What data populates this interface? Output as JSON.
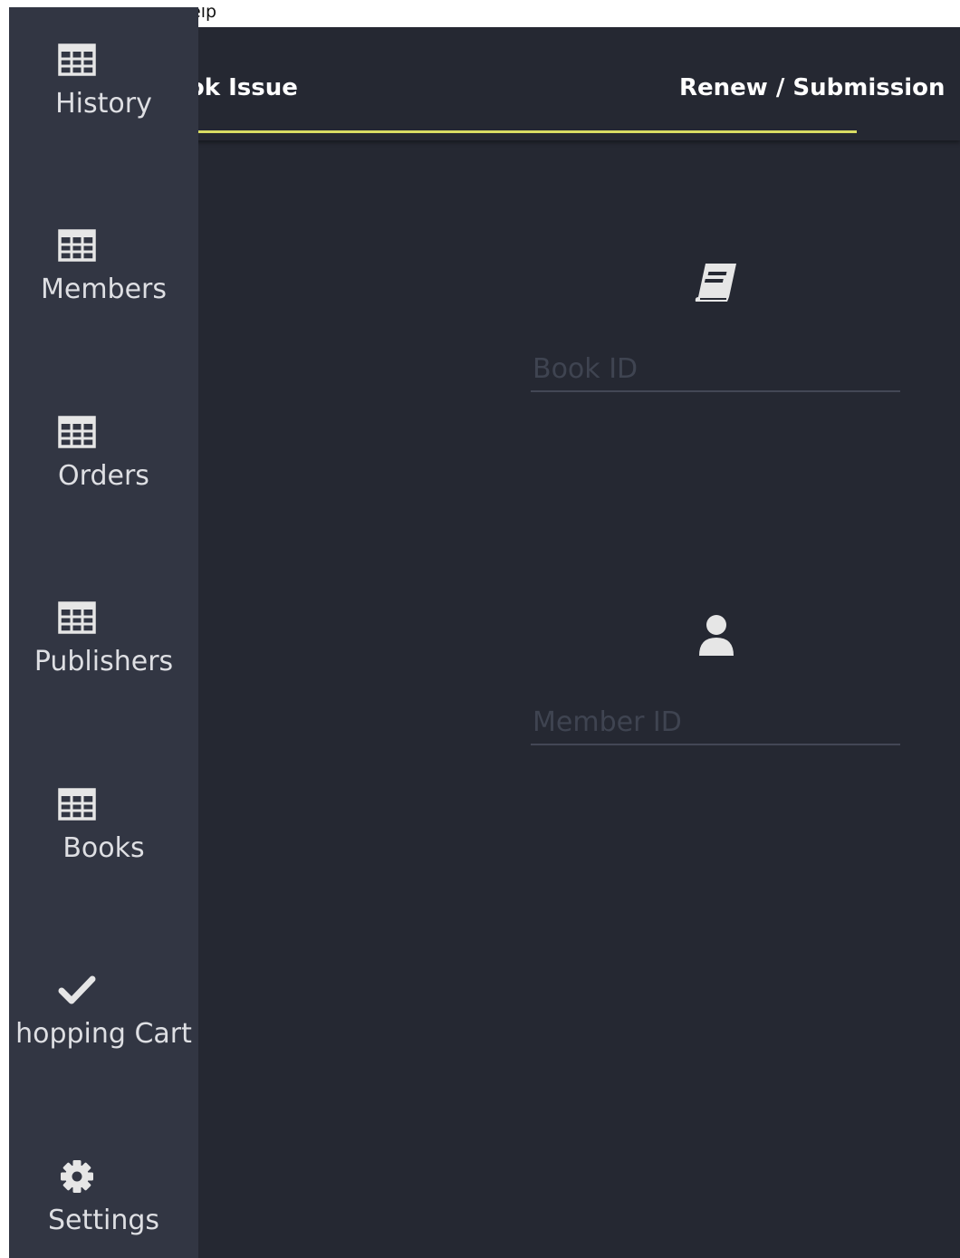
{
  "menubar": {
    "help_label": "elp"
  },
  "tabs": [
    {
      "label": "ook Issue",
      "active": true
    },
    {
      "label": "Renew / Submission",
      "active": false
    }
  ],
  "accent_color": "#d8dc63",
  "sidebar": {
    "items": [
      {
        "label": "History",
        "icon": "table-icon"
      },
      {
        "label": "Members",
        "icon": "table-icon"
      },
      {
        "label": "Orders",
        "icon": "table-icon"
      },
      {
        "label": "Publishers",
        "icon": "table-icon"
      },
      {
        "label": "Books",
        "icon": "table-icon"
      },
      {
        "label": "hopping Cart",
        "icon": "check-icon"
      },
      {
        "label": "Settings",
        "icon": "gear-icon"
      }
    ]
  },
  "form": {
    "book_id": {
      "icon": "book-icon",
      "placeholder": "Book ID",
      "value": ""
    },
    "member_id": {
      "icon": "user-icon",
      "placeholder": "Member ID",
      "value": ""
    }
  }
}
